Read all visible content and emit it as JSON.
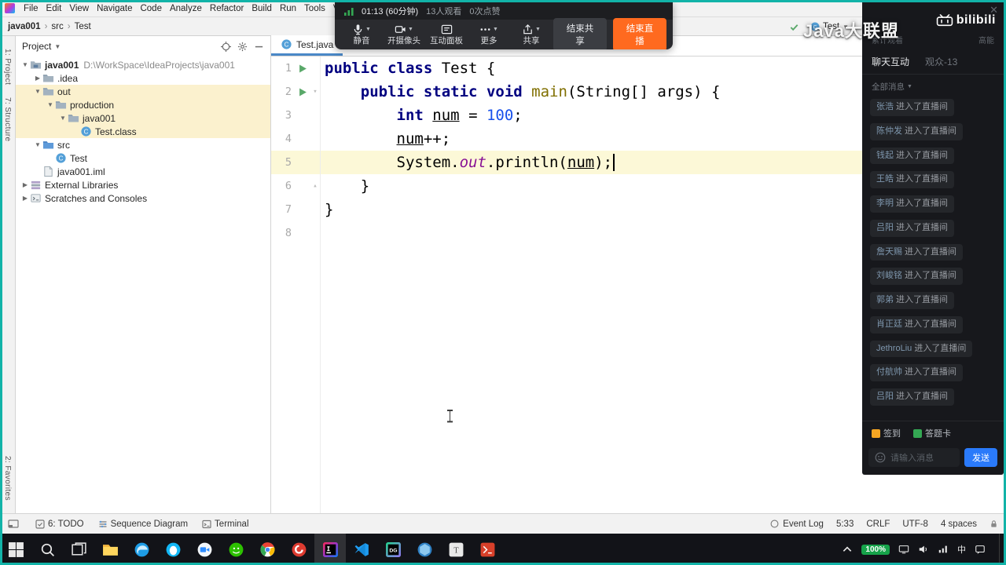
{
  "window": {
    "share_border_color": "#12b3a8"
  },
  "ide": {
    "menu_items": [
      "File",
      "Edit",
      "View",
      "Navigate",
      "Code",
      "Analyze",
      "Refactor",
      "Build",
      "Run",
      "Tools",
      "VCS"
    ],
    "breadcrumb": [
      {
        "label": "java001",
        "bold": true
      },
      {
        "label": "src",
        "bold": false
      },
      {
        "label": "Test",
        "bold": false
      }
    ],
    "toolbar_right": {
      "run_config": "Test"
    },
    "side_tabs_left": [
      "1: Project",
      "7: Structure",
      "2: Favorites"
    ],
    "project_panel": {
      "title": "Project",
      "tree": [
        {
          "d": 0,
          "arrow": "down",
          "icon": "project",
          "label": "java001",
          "bold": true,
          "sub": "D:\\WorkSpace\\IdeaProjects\\java001"
        },
        {
          "d": 1,
          "arrow": "right",
          "icon": "folder",
          "label": ".idea"
        },
        {
          "d": 1,
          "arrow": "down",
          "icon": "folder",
          "label": "out",
          "hl": true
        },
        {
          "d": 2,
          "arrow": "down",
          "icon": "folder",
          "label": "production",
          "hl": true
        },
        {
          "d": 3,
          "arrow": "down",
          "icon": "folder",
          "label": "java001",
          "hl": true
        },
        {
          "d": 4,
          "arrow": null,
          "icon": "class",
          "label": "Test.class",
          "hl": true
        },
        {
          "d": 1,
          "arrow": "down",
          "icon": "src",
          "label": "src"
        },
        {
          "d": 2,
          "arrow": null,
          "icon": "class",
          "label": "Test"
        },
        {
          "d": 1,
          "arrow": null,
          "icon": "file",
          "label": "java001.iml"
        },
        {
          "d": 0,
          "arrow": "right",
          "icon": "libs",
          "label": "External Libraries"
        },
        {
          "d": 0,
          "arrow": "right",
          "icon": "scratch",
          "label": "Scratches and Consoles"
        }
      ]
    },
    "editor": {
      "tab": "Test.java",
      "lines": [
        {
          "num": 1,
          "run": true,
          "segs": [
            [
              "kw",
              "public"
            ],
            [
              "p",
              " "
            ],
            [
              "kw",
              "class"
            ],
            [
              "p",
              " Test {"
            ]
          ]
        },
        {
          "num": 2,
          "run": true,
          "fold": "down",
          "segs": [
            [
              "p",
              "    "
            ],
            [
              "kw",
              "public"
            ],
            [
              "p",
              " "
            ],
            [
              "kw",
              "static"
            ],
            [
              "p",
              " "
            ],
            [
              "kw",
              "void"
            ],
            [
              "p",
              " "
            ],
            [
              "mth",
              "main"
            ],
            [
              "p",
              "(String[] args) {"
            ]
          ]
        },
        {
          "num": 3,
          "segs": [
            [
              "p",
              "        "
            ],
            [
              "kw",
              "int"
            ],
            [
              "p",
              " "
            ],
            [
              "var",
              "num"
            ],
            [
              "p",
              " = "
            ],
            [
              "num",
              "100"
            ],
            [
              "p",
              ";"
            ]
          ]
        },
        {
          "num": 4,
          "segs": [
            [
              "p",
              "        "
            ],
            [
              "var",
              "num"
            ],
            [
              "p",
              "++;"
            ]
          ]
        },
        {
          "num": 5,
          "current": true,
          "caret": true,
          "segs": [
            [
              "p",
              "        System."
            ],
            [
              "fld",
              "out"
            ],
            [
              "p",
              ".println("
            ],
            [
              "var",
              "num"
            ],
            [
              "p",
              ");"
            ]
          ]
        },
        {
          "num": 6,
          "fold": "up",
          "segs": [
            [
              "p",
              "    }"
            ]
          ]
        },
        {
          "num": 7,
          "segs": [
            [
              "p",
              "}"
            ]
          ]
        },
        {
          "num": 8,
          "segs": []
        }
      ]
    },
    "status_bar": {
      "tools": [
        "6: TODO",
        "Sequence Diagram",
        "Terminal"
      ],
      "event_log": "Event Log",
      "caret_pos": "5:33",
      "line_ending": "CRLF",
      "encoding": "UTF-8",
      "indent": "4 spaces"
    }
  },
  "stream_bar": {
    "duration": "01:13 (60分钟)",
    "viewers": "13人观看",
    "likes": "0次点赞",
    "buttons": [
      {
        "label": "静音",
        "icon": "microphone",
        "dropdown": true
      },
      {
        "label": "开摄像头",
        "icon": "camera",
        "dropdown": true
      },
      {
        "label": "互动面板",
        "icon": "panel",
        "dropdown": false
      },
      {
        "label": "更多",
        "icon": "more",
        "dropdown": true
      },
      {
        "label": "共享",
        "icon": "share",
        "dropdown": true
      }
    ],
    "end_share": "结束共享",
    "end_live": "结束直播"
  },
  "watermark": "Java大联盟",
  "live_panel": {
    "brand": "bilibili",
    "stats": [
      {
        "label": "累计观看"
      },
      {
        "label": "高能"
      }
    ],
    "tabs": [
      {
        "label": "聊天互动",
        "active": true
      },
      {
        "label": "观众-13",
        "active": false
      }
    ],
    "filter": "全部消息",
    "messages": [
      {
        "user": "张浩",
        "action": "进入了直播间"
      },
      {
        "user": "陈仲发",
        "action": "进入了直播间"
      },
      {
        "user": "钱起",
        "action": "进入了直播间"
      },
      {
        "user": "王皓",
        "action": "进入了直播间"
      },
      {
        "user": "李明",
        "action": "进入了直播间"
      },
      {
        "user": "吕阳",
        "action": "进入了直播间"
      },
      {
        "user": "詹天赐",
        "action": "进入了直播间"
      },
      {
        "user": "刘峻铭",
        "action": "进入了直播间"
      },
      {
        "user": "郭弟",
        "action": "进入了直播间"
      },
      {
        "user": "肖正廷",
        "action": "进入了直播间"
      },
      {
        "user": "JethroLiu",
        "action": "进入了直播间"
      },
      {
        "user": "付航帅",
        "action": "进入了直播间"
      },
      {
        "user": "吕阳",
        "action": "进入了直播间"
      }
    ],
    "signin": "签到",
    "answer_card": "答题卡",
    "input_placeholder": "请输入消息",
    "send": "发送"
  },
  "taskbar": {
    "apps": [
      {
        "name": "search"
      },
      {
        "name": "task-view"
      },
      {
        "name": "file-explorer"
      },
      {
        "name": "edge-browser"
      },
      {
        "name": "qq"
      },
      {
        "name": "tencent-meeting"
      },
      {
        "name": "wechat"
      },
      {
        "name": "chrome"
      },
      {
        "name": "netease-music"
      },
      {
        "name": "intellij-idea",
        "active": true
      },
      {
        "name": "vscode"
      },
      {
        "name": "datagrip"
      },
      {
        "name": "navicat"
      },
      {
        "name": "typora"
      },
      {
        "name": "xshell"
      }
    ],
    "tray": {
      "battery": "100%",
      "ime": "中"
    }
  }
}
